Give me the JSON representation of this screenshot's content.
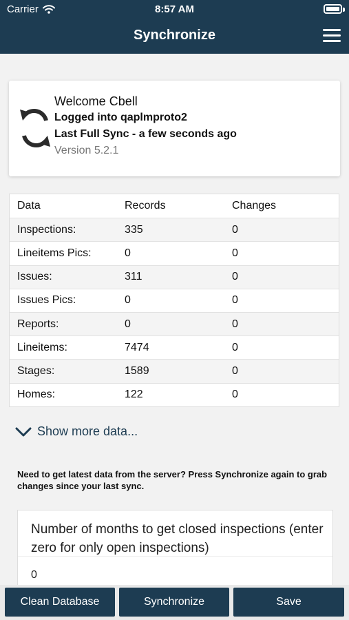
{
  "status_bar": {
    "carrier": "Carrier",
    "time": "8:57 AM"
  },
  "header": {
    "title": "Synchronize"
  },
  "info": {
    "welcome": "Welcome Cbell",
    "logged_in": "Logged into qaplmproto2",
    "last_sync": "Last Full Sync - a few seconds ago",
    "version": "Version 5.2.1"
  },
  "table": {
    "headers": [
      "Data",
      "Records",
      "Changes"
    ],
    "rows": [
      [
        "Inspections:",
        "335",
        "0"
      ],
      [
        "Lineitems Pics:",
        "0",
        "0"
      ],
      [
        "Issues:",
        "311",
        "0"
      ],
      [
        "Issues Pics:",
        "0",
        "0"
      ],
      [
        "Reports:",
        "0",
        "0"
      ],
      [
        "Lineitems:",
        "7474",
        "0"
      ],
      [
        "Stages:",
        "1589",
        "0"
      ],
      [
        "Homes:",
        "122",
        "0"
      ]
    ]
  },
  "show_more": "Show more data...",
  "note": "Need to get latest data from the server? Press Synchronize again to grab changes since your last sync.",
  "months": {
    "label": "Number of months to get closed inspections (enter zero for only open inspections)",
    "value": "0"
  },
  "buttons": {
    "clean": "Clean Database",
    "sync": "Synchronize",
    "save": "Save"
  },
  "colors": {
    "primary": "#1d3c52",
    "background": "#f2f2f2"
  }
}
